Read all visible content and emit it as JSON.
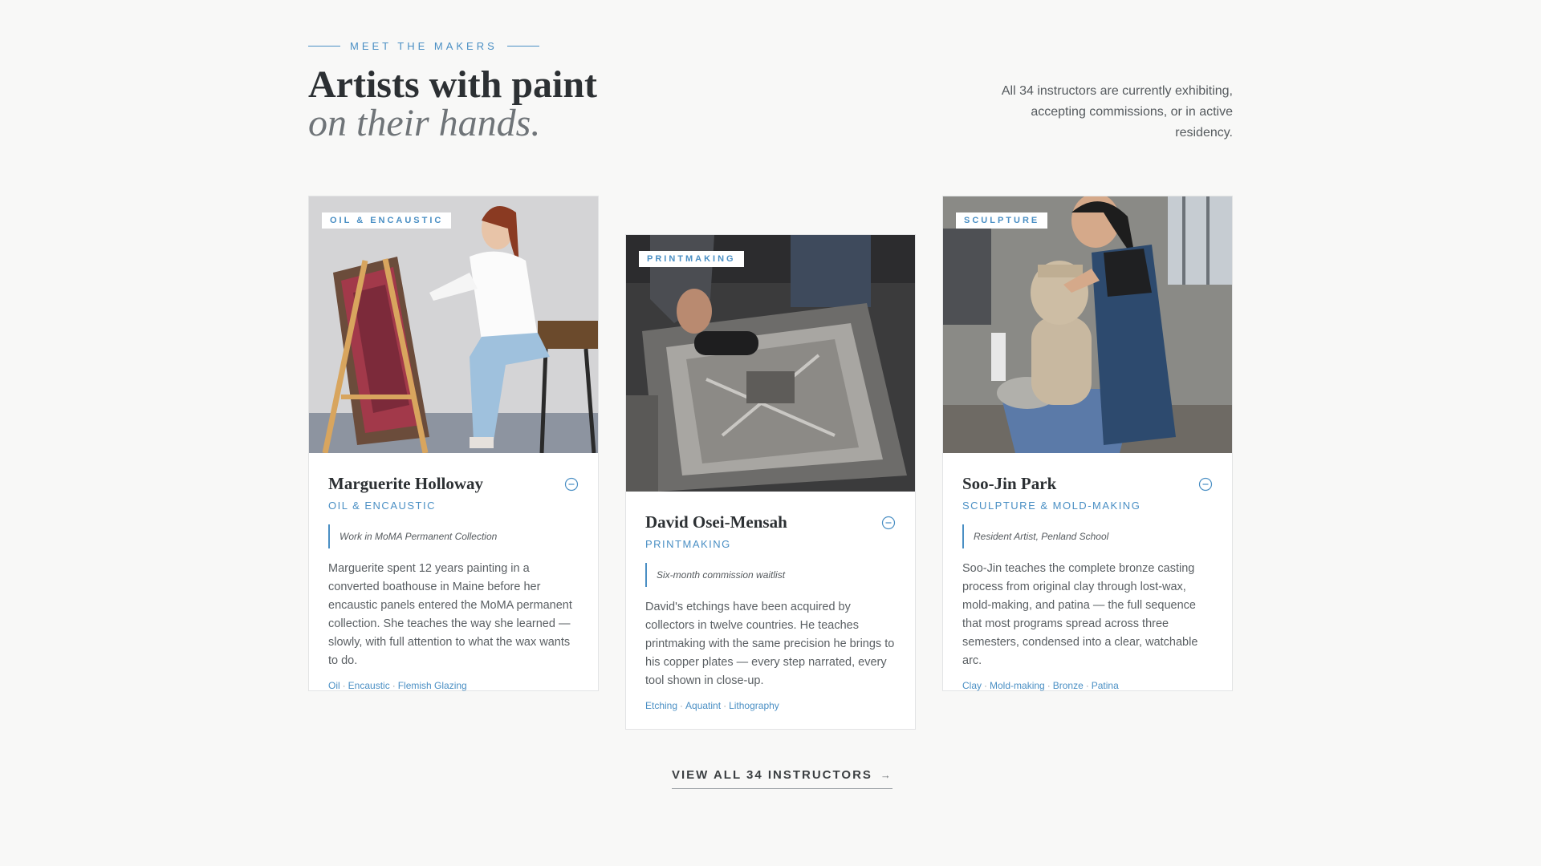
{
  "header": {
    "eyebrow": "MEET THE MAKERS",
    "title": "Artists with paint",
    "subtitle": "on their hands.",
    "intro": "All 34 instructors are currently exhibiting, accepting commissions, or in active residency."
  },
  "cards": [
    {
      "tag": "OIL & ENCAUSTIC",
      "name": "Marguerite Holloway",
      "discipline": "OIL & ENCAUSTIC",
      "credential": "Work in MoMA Permanent Collection",
      "bio": "Marguerite spent 12 years painting in a converted boathouse in Maine before her encaustic panels entered the MoMA permanent collection. She teaches the way she learned — slowly, with full attention to what the wax wants to do.",
      "skills": [
        "Oil",
        "Encaustic",
        "Flemish Glazing"
      ]
    },
    {
      "tag": "PRINTMAKING",
      "name": "David Osei-Mensah",
      "discipline": "PRINTMAKING",
      "credential": "Six-month commission waitlist",
      "bio": "David's etchings have been acquired by collectors in twelve countries. He teaches printmaking with the same precision he brings to his copper plates — every step narrated, every tool shown in close-up.",
      "skills": [
        "Etching",
        "Aquatint",
        "Lithography"
      ]
    },
    {
      "tag": "SCULPTURE",
      "name": "Soo-Jin Park",
      "discipline": "SCULPTURE & MOLD-MAKING",
      "credential": "Resident Artist, Penland School",
      "bio": "Soo-Jin teaches the complete bronze casting process from original clay through lost-wax, mold-making, and patina — the full sequence that most programs spread across three semesters, condensed into a clear, watchable arc.",
      "skills": [
        "Clay",
        "Mold-making",
        "Bronze",
        "Patina"
      ]
    }
  ],
  "cta": {
    "label": "VIEW ALL 34 INSTRUCTORS",
    "arrow": "→"
  },
  "colors": {
    "accent": "#4a8fc4",
    "heading": "#2c3033",
    "background": "#f8f8f7"
  }
}
